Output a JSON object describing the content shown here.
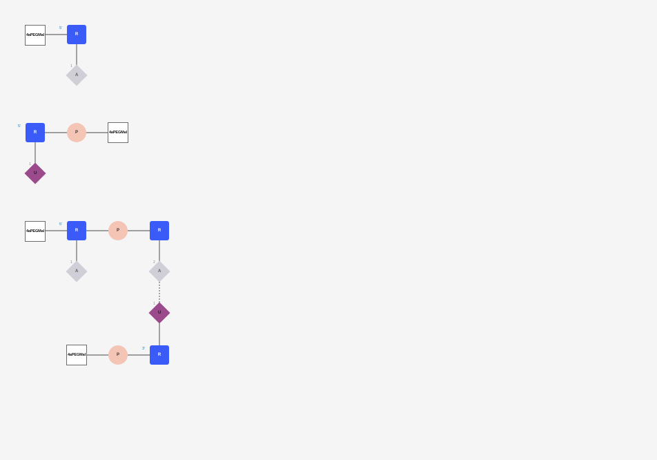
{
  "colors": {
    "background": "#f5f5f5",
    "sugar": "#3a5bf7",
    "phosphate": "#f4c5b5",
    "base_A": "#d0cfd8",
    "base_U": "#9b4a8c",
    "link": "#6b6b6b",
    "end_label": "#1a7fc0"
  },
  "labels": {
    "mod": "4aPEGMal",
    "sugar": "R",
    "phosphate": "P",
    "base_a": "A",
    "base_u": "U",
    "five_prime": "5'",
    "three_prime": "3'",
    "one": "1",
    "two": "2"
  }
}
